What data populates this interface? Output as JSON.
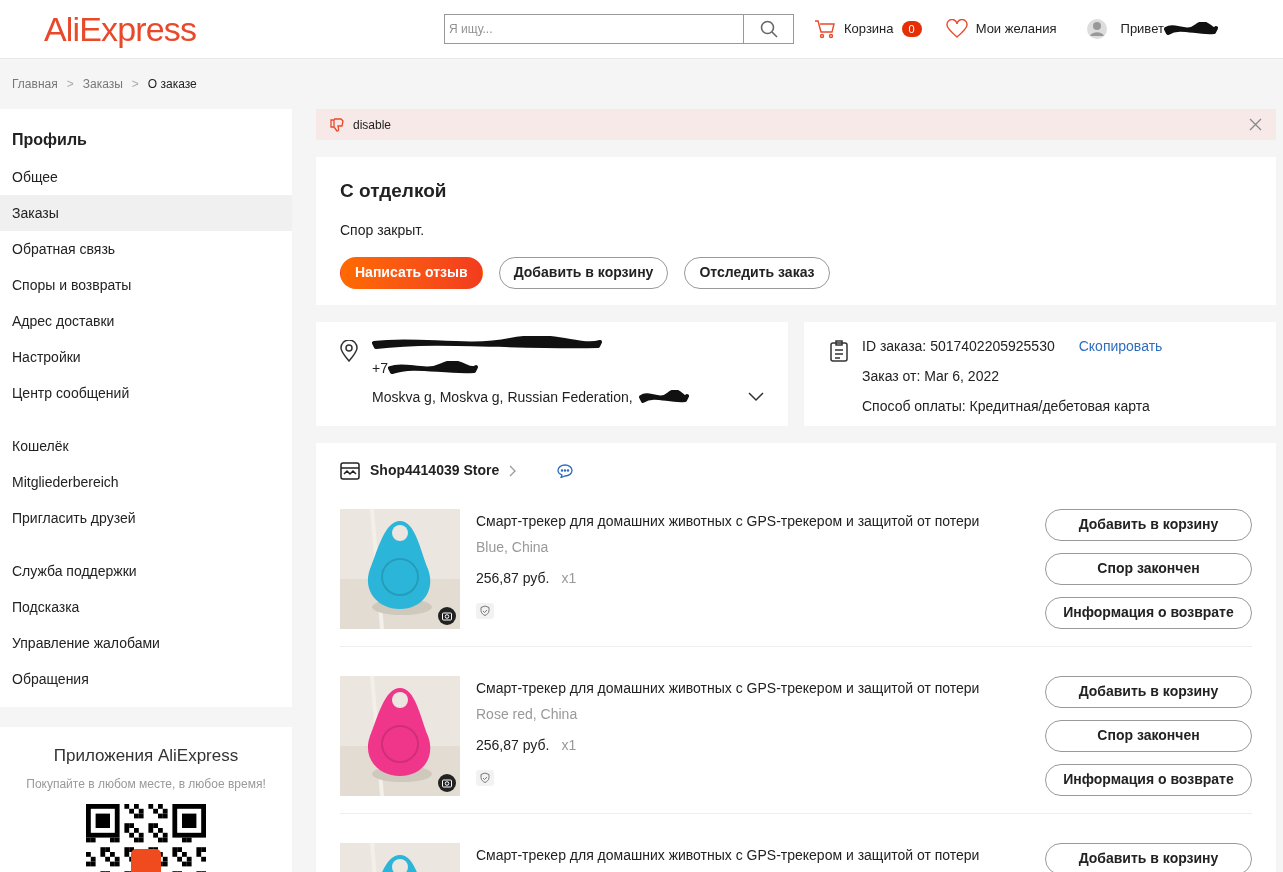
{
  "header": {
    "logo": "AliExpress",
    "search": {
      "placeholder": "Я ищу..."
    },
    "cart": {
      "label": "Корзина",
      "count": "0"
    },
    "wishlist": "Мои желания",
    "greeting": "Привет"
  },
  "breadcrumbs": [
    {
      "label": "Главная",
      "kind": "link"
    },
    {
      "label": ">",
      "kind": "separator"
    },
    {
      "label": "Заказы",
      "kind": "link"
    },
    {
      "label": ">",
      "kind": "separator"
    },
    {
      "label": "О заказе",
      "kind": "current"
    }
  ],
  "sidebar": {
    "title": "Профиль",
    "groups": [
      [
        {
          "label": "Общее",
          "selected": false
        },
        {
          "label": "Заказы",
          "selected": true
        },
        {
          "label": "Обратная связь",
          "selected": false
        },
        {
          "label": "Споры и возвраты",
          "selected": false
        },
        {
          "label": "Адрес доставки",
          "selected": false
        },
        {
          "label": "Настройки",
          "selected": false
        },
        {
          "label": "Центр сообщений",
          "selected": false
        }
      ],
      [
        {
          "label": "Кошелёк",
          "selected": false
        },
        {
          "label": "Mitgliederbereich",
          "selected": false
        },
        {
          "label": "Пригласить друзей",
          "selected": false
        }
      ],
      [
        {
          "label": "Служба поддержки",
          "selected": false
        },
        {
          "label": "Подсказка",
          "selected": false
        },
        {
          "label": "Управление жалобами",
          "selected": false
        },
        {
          "label": "Обращения",
          "selected": false
        }
      ]
    ]
  },
  "app_promo": {
    "title": "Приложения AliExpress",
    "subtitle": "Покупайте в любом месте, в любое время!"
  },
  "notice": {
    "text": "disable"
  },
  "status_card": {
    "title": "С отделкой",
    "message": "Спор закрыт.",
    "buttons": [
      {
        "label": "Написать отзыв",
        "kind": "primary"
      },
      {
        "label": "Добавить в корзину",
        "kind": "outline"
      },
      {
        "label": "Отследить заказ",
        "kind": "outline"
      }
    ]
  },
  "address": {
    "phone_prefix": "+7",
    "city": "Moskva g, Moskva g, Russian Federation,"
  },
  "order_info": {
    "id": "ID заказа: 5017402205925530",
    "copy": "Скопировать",
    "date": "Заказ от: Mar 6, 2022",
    "payment": "Способ оплаты: Кредитная/дебетовая карта"
  },
  "store": {
    "name": "Shop4414039 Store",
    "items": [
      {
        "title": "Смарт-трекер для домашних животных с GPS-трекером и защитой от потери",
        "variant": "Blue, China",
        "price": "256,87 руб.",
        "quantity": "x1",
        "buttons": [
          "Добавить в корзину",
          "Спор закончен",
          "Информация о возврате"
        ]
      },
      {
        "title": "Смарт-трекер для домашних животных с GPS-трекером и защитой от потери",
        "variant": "Rose red, China",
        "price": "256,87 руб.",
        "quantity": "x1",
        "buttons": [
          "Добавить в корзину",
          "Спор закончен",
          "Информация о возврате"
        ]
      },
      {
        "title": "Смарт-трекер для домашних животных с GPS-трекером и защитой от потери",
        "buttons": [
          "Добавить в корзину"
        ]
      }
    ]
  }
}
